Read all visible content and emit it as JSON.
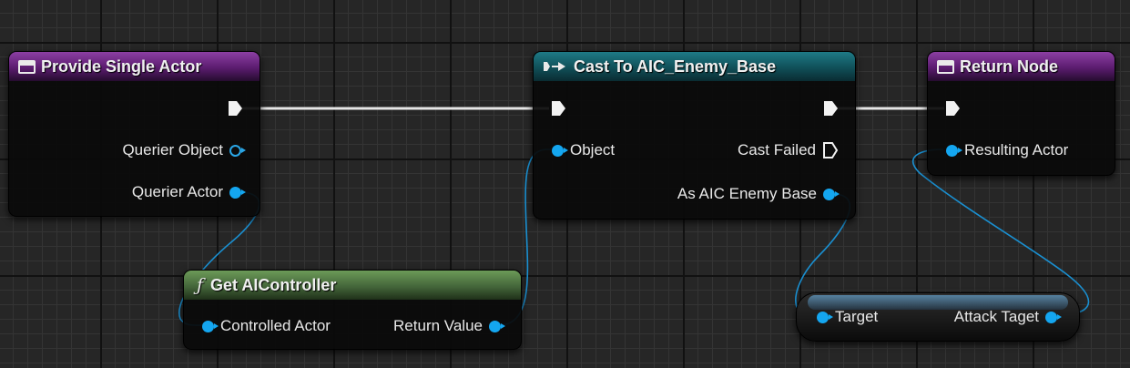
{
  "nodes": {
    "provide_single_actor": {
      "title": "Provide Single Actor",
      "pins": {
        "querier_object": "Querier Object",
        "querier_actor": "Querier Actor"
      }
    },
    "cast": {
      "title": "Cast To AIC_Enemy_Base",
      "pins": {
        "object": "Object",
        "cast_failed": "Cast Failed",
        "as_aic_enemy_base": "As AIC Enemy Base"
      }
    },
    "return_node": {
      "title": "Return Node",
      "pins": {
        "resulting_actor": "Resulting Actor"
      }
    },
    "get_aicontroller": {
      "title": "Get AIController",
      "pins": {
        "controlled_actor": "Controlled Actor",
        "return_value": "Return Value"
      }
    },
    "attack_target": {
      "pins": {
        "target": "Target",
        "attack_taget": "Attack Taget"
      }
    }
  },
  "colors": {
    "function_header": "#5b1c6f",
    "cast_header": "#104f58",
    "pure_header": "#44663a",
    "object_pin": "#14a6f0",
    "exec_wire": "#e6e6e6"
  },
  "icons": {
    "function": "function-node-icon",
    "cast": "cast-exec-icon",
    "pure": "f-function-icon"
  }
}
